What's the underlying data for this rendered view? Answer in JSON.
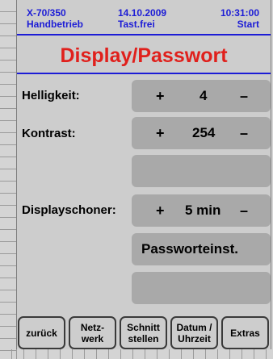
{
  "status": {
    "device": "X-70/350",
    "mode": "Handbetrieb",
    "date": "14.10.2009",
    "keys": "Tast.frei",
    "time": "10:31:00",
    "state": "Start"
  },
  "title": "Display/Passwort",
  "settings": {
    "brightness": {
      "label": "Helligkeit:",
      "plus": "+",
      "value": "4",
      "minus": "–"
    },
    "contrast": {
      "label": "Kontrast:",
      "plus": "+",
      "value": "254",
      "minus": "–"
    },
    "screensaver": {
      "label": "Displayschoner:",
      "plus": "+",
      "value": "5 min",
      "minus": "–"
    },
    "password_button": "Passworteinst."
  },
  "softkeys": {
    "back": "zurück",
    "network": "Netz-\nwerk",
    "interface": "Schnitt\nstellen",
    "datetime": "Datum /\nUhrzeit",
    "extras": "Extras"
  },
  "colors": {
    "accent_blue": "#1c1cd6",
    "title_red": "#e0201c",
    "button_gray": "#a9a9a9"
  }
}
